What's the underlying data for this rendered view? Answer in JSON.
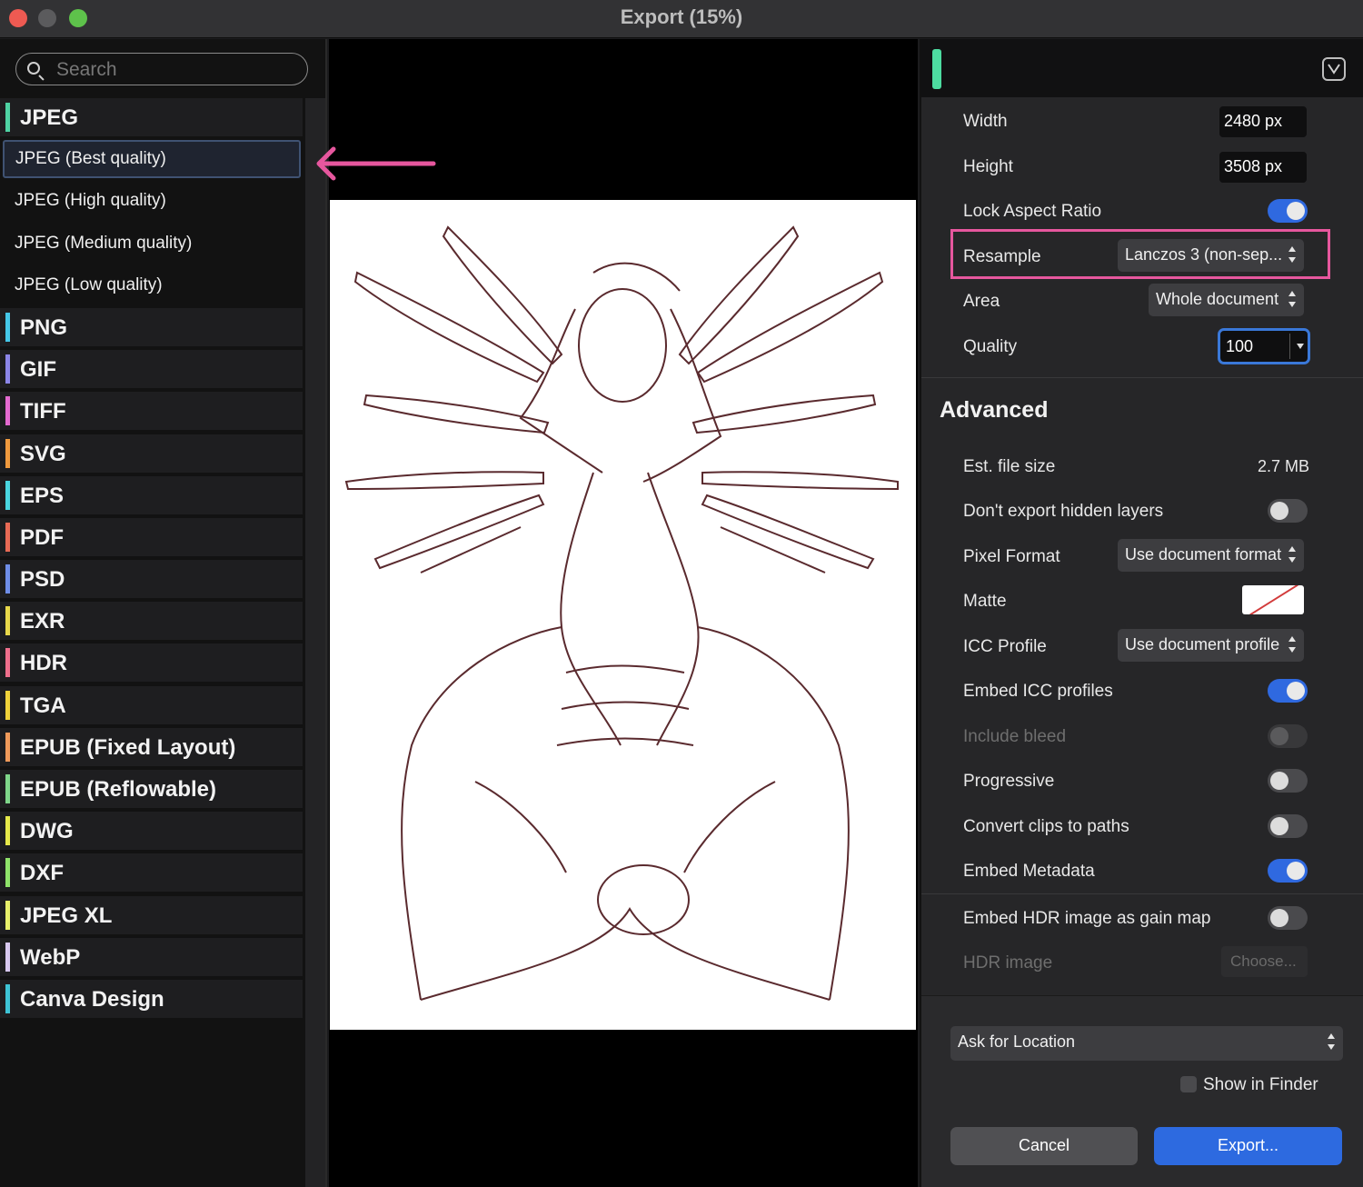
{
  "window": {
    "title": "Export (15%)"
  },
  "search": {
    "placeholder": "Search"
  },
  "formats": [
    {
      "label": "JPEG",
      "color": "#4fd3a4",
      "presets": [
        "JPEG (Best quality)",
        "JPEG (High quality)",
        "JPEG (Medium quality)",
        "JPEG (Low quality)"
      ],
      "selected_preset": "JPEG (Best quality)"
    },
    {
      "label": "PNG",
      "color": "#45c7e8"
    },
    {
      "label": "GIF",
      "color": "#8c86e8"
    },
    {
      "label": "TIFF",
      "color": "#e46ad0"
    },
    {
      "label": "SVG",
      "color": "#f09a3e"
    },
    {
      "label": "EPS",
      "color": "#4ad6e0"
    },
    {
      "label": "PDF",
      "color": "#e86a55"
    },
    {
      "label": "PSD",
      "color": "#6f8ee8"
    },
    {
      "label": "EXR",
      "color": "#e8d84a"
    },
    {
      "label": "HDR",
      "color": "#ef6f8c"
    },
    {
      "label": "TGA",
      "color": "#f0d23a"
    },
    {
      "label": "EPUB (Fixed Layout)",
      "color": "#f09a5a"
    },
    {
      "label": "EPUB (Reflowable)",
      "color": "#7fd68a"
    },
    {
      "label": "DWG",
      "color": "#e6e94a"
    },
    {
      "label": "DXF",
      "color": "#8fe36a"
    },
    {
      "label": "JPEG XL",
      "color": "#e8f06a"
    },
    {
      "label": "WebP",
      "color": "#d8c8f0"
    },
    {
      "label": "Canva Design",
      "color": "#3ec4d6"
    }
  ],
  "settings": {
    "width_label": "Width",
    "width_value": "2480 px",
    "height_label": "Height",
    "height_value": "3508 px",
    "lock_label": "Lock Aspect Ratio",
    "lock_on": true,
    "resample_label": "Resample",
    "resample_value": "Lanczos 3 (non-sep...",
    "area_label": "Area",
    "area_value": "Whole document",
    "quality_label": "Quality",
    "quality_value": "100"
  },
  "advanced": {
    "title": "Advanced",
    "filesize_label": "Est. file size",
    "filesize_value": "2.7 MB",
    "hidden_layers_label": "Don't export hidden layers",
    "hidden_layers_on": false,
    "pixel_format_label": "Pixel Format",
    "pixel_format_value": "Use document format",
    "matte_label": "Matte",
    "icc_label": "ICC Profile",
    "icc_value": "Use document profile",
    "embed_icc_label": "Embed ICC profiles",
    "embed_icc_on": true,
    "bleed_label": "Include bleed",
    "bleed_on": false,
    "progressive_label": "Progressive",
    "progressive_on": false,
    "clips_label": "Convert clips to paths",
    "clips_on": false,
    "metadata_label": "Embed Metadata",
    "metadata_on": true,
    "hdr_gain_label": "Embed HDR image as gain map",
    "hdr_gain_on": false,
    "hdr_image_label": "HDR image",
    "hdr_choose_label": "Choose..."
  },
  "footer": {
    "location_value": "Ask for Location",
    "show_in_finder_label": "Show in Finder",
    "show_in_finder_checked": false,
    "cancel_label": "Cancel",
    "export_label": "Export..."
  },
  "colors": {
    "accent_blue": "#2d6ae0",
    "highlight_pink": "#e6579e",
    "panel_accent": "#4ddca0"
  }
}
